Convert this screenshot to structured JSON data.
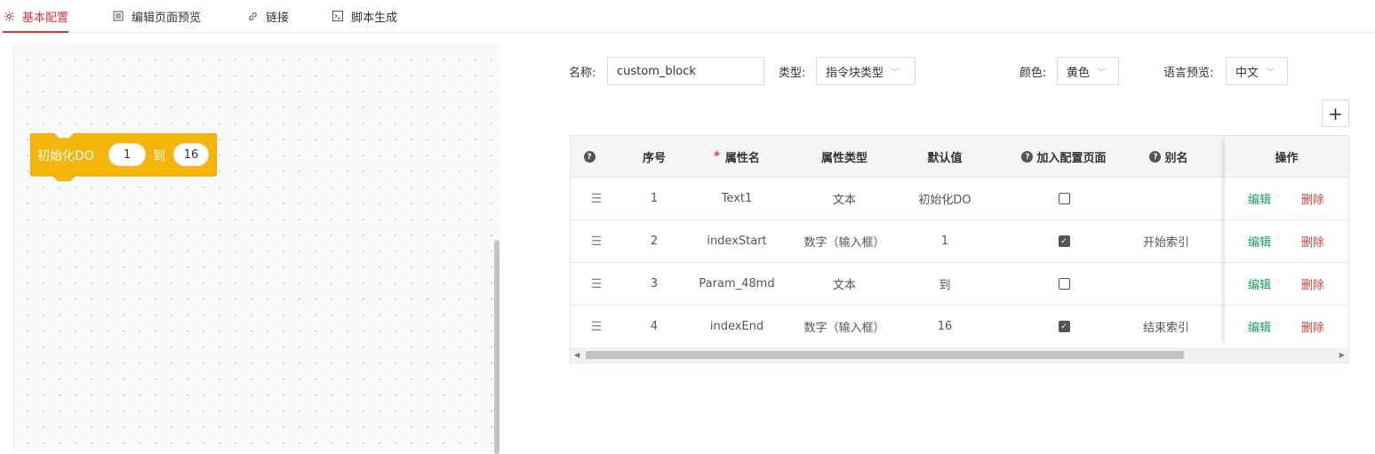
{
  "tabs": [
    {
      "label": "基本配置",
      "icon": "gear-icon",
      "active": true
    },
    {
      "label": "编辑页面预览",
      "icon": "document-icon",
      "active": false
    },
    {
      "label": "链接",
      "icon": "link-icon",
      "active": false
    },
    {
      "label": "脚本生成",
      "icon": "terminal-icon",
      "active": false
    }
  ],
  "block": {
    "label": "初始化DO",
    "start": "1",
    "to_label": "到",
    "end": "16",
    "color": "#f5b50a"
  },
  "form": {
    "name_label": "名称:",
    "name_value": "custom_block",
    "type_label": "类型:",
    "type_value": "指令块类型",
    "color_label": "颜色:",
    "color_value": "黄色",
    "lang_label": "语言预览:",
    "lang_value": "中文"
  },
  "add_button": "+",
  "table": {
    "headers": {
      "index": "序号",
      "attr_name": "属性名",
      "attr_type": "属性类型",
      "default": "默认值",
      "add_config": "加入配置页面",
      "alias": "别名",
      "actions": "操作"
    },
    "required_mark": "*",
    "rows": [
      {
        "index": "1",
        "name": "Text1",
        "type": "文本",
        "default": "初始化DO",
        "checked": false,
        "alias": ""
      },
      {
        "index": "2",
        "name": "indexStart",
        "type": "数字（输入框）",
        "default": "1",
        "checked": true,
        "alias": "开始索引"
      },
      {
        "index": "3",
        "name": "Param_48md",
        "type": "文本",
        "default": "到",
        "checked": false,
        "alias": ""
      },
      {
        "index": "4",
        "name": "indexEnd",
        "type": "数字（输入框）",
        "default": "16",
        "checked": true,
        "alias": "结束索引"
      }
    ],
    "edit_label": "编辑",
    "delete_label": "删除"
  },
  "colors": {
    "accent": "#d9363e",
    "edit": "#19a05c",
    "delete": "#e0453d",
    "block": "#f5b50a"
  }
}
